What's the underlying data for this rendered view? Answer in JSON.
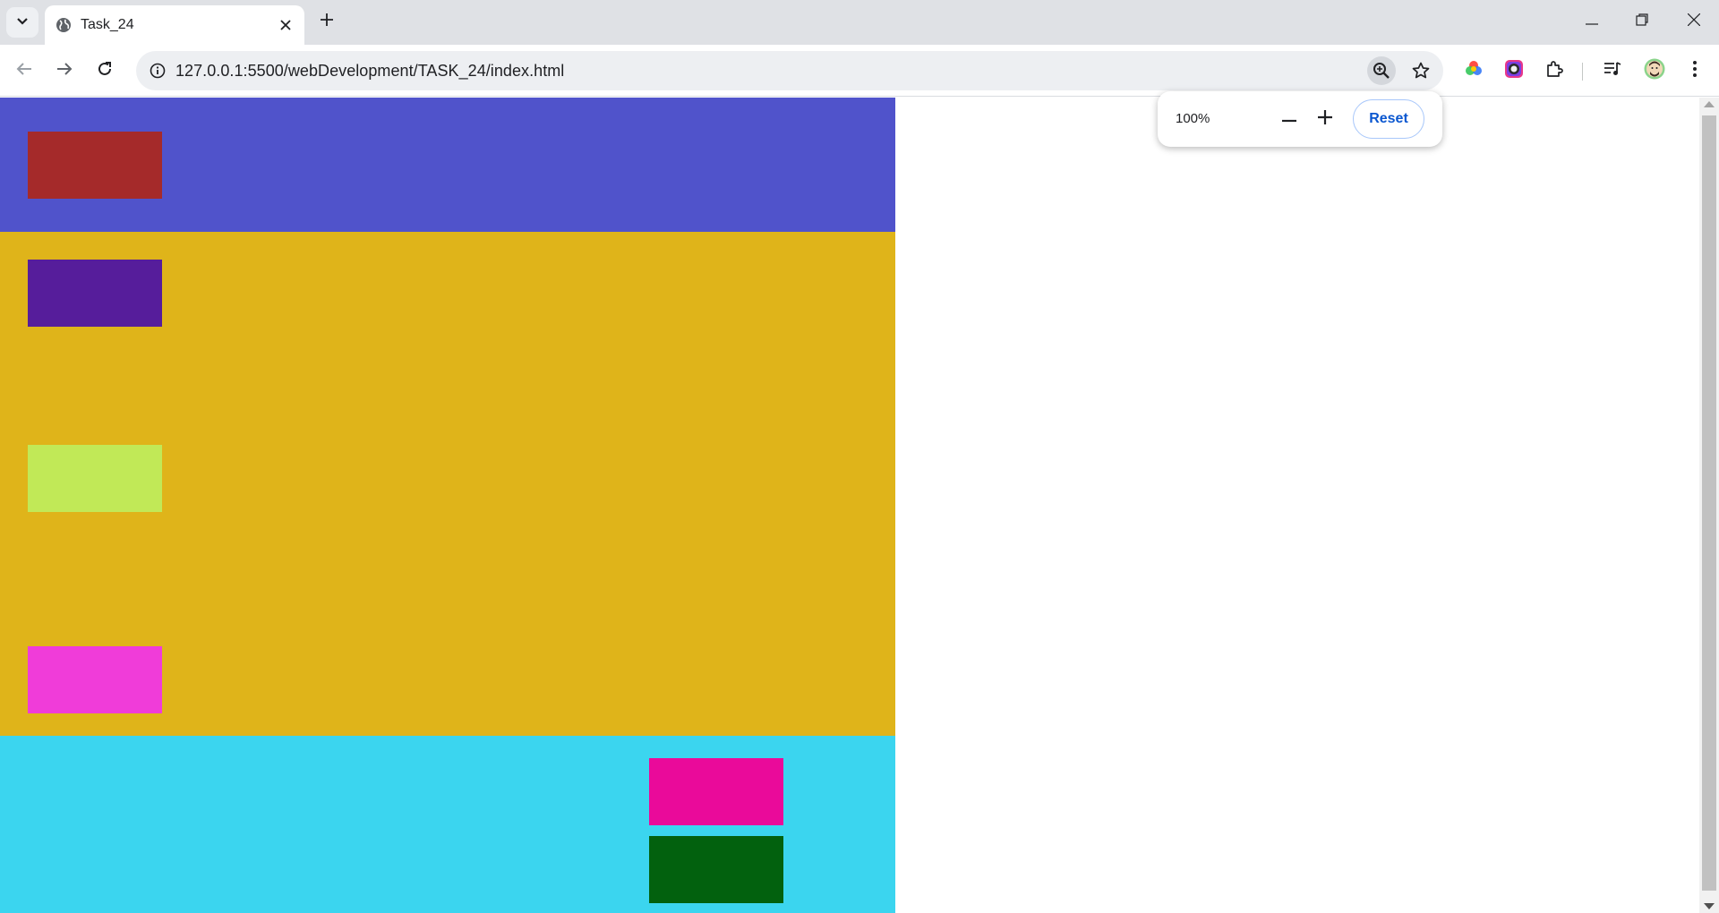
{
  "browser": {
    "tab": {
      "title": "Task_24"
    },
    "omnibox": {
      "url": "127.0.0.1:5500/webDevelopment/TASK_24/index.html"
    },
    "icons": [
      "tab-search-icon",
      "globe-icon",
      "close-icon",
      "plus-icon",
      "minimize-icon",
      "restore-icon",
      "window-close-icon",
      "back-arrow-icon",
      "forward-arrow-icon",
      "reload-icon",
      "site-info-icon",
      "zoom-icon",
      "star-icon",
      "color-wheel-icon",
      "color-picker-icon",
      "puzzle-icon",
      "media-queue-icon",
      "avatar-icon",
      "kebab-menu-icon"
    ]
  },
  "zoom_popup": {
    "level": "100%",
    "reset_label": "Reset"
  },
  "page": {
    "sections": [
      {
        "name": "top",
        "color": "#5053cb"
      },
      {
        "name": "middle",
        "color": "#dfb41a"
      },
      {
        "name": "bottom",
        "color": "#3bd5ef"
      }
    ],
    "boxes": [
      {
        "color": "#a52a2a"
      },
      {
        "color": "#561d9b"
      },
      {
        "color": "#c1e957"
      },
      {
        "color": "#f03cd9"
      },
      {
        "color": "#ea0a9a"
      },
      {
        "color": "#02610e"
      }
    ]
  }
}
